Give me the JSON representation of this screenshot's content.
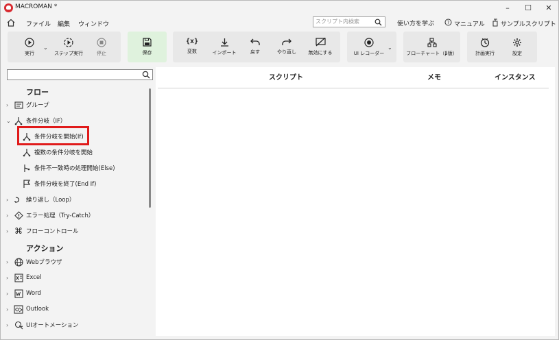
{
  "window": {
    "title": "MACROMAN *",
    "controls": [
      "minimize",
      "maximize",
      "close"
    ]
  },
  "menu": {
    "items": [
      "ファイル",
      "編集",
      "ウィンドウ"
    ],
    "search_placeholder": "スクリプト内検索",
    "links": [
      "使い方を学ぶ",
      "マニュアル",
      "サンプルスクリプト"
    ]
  },
  "toolbar": {
    "run": "実行",
    "step_run": "ステップ実行",
    "stop": "停止",
    "save": "保存",
    "variables": "変数",
    "import": "インポート",
    "undo": "戻す",
    "redo": "やり直し",
    "disable": "無効にする",
    "ui_recorder": "UI レコーダー",
    "flowchart": "フローチャート（β版）",
    "schedule": "計画実行",
    "settings": "設定"
  },
  "sidebar": {
    "section_flow": "フロー",
    "section_action": "アクション",
    "items": [
      {
        "label": "グループ",
        "icon": "group-icon"
      },
      {
        "label": "条件分岐（IF）",
        "icon": "branch-icon"
      },
      {
        "label": "条件分岐を開始(If)",
        "icon": "branch-icon"
      },
      {
        "label": "複数の条件分岐を開始",
        "icon": "branch-icon"
      },
      {
        "label": "条件不一致時の処理開始(Else)",
        "icon": "else-icon"
      },
      {
        "label": "条件分岐を終了(End If)",
        "icon": "flag-icon"
      },
      {
        "label": "繰り返し（Loop）",
        "icon": "loop-icon"
      },
      {
        "label": "エラー処理（Try-Catch）",
        "icon": "warning-icon"
      },
      {
        "label": "フローコントロール",
        "icon": "command-icon"
      },
      {
        "label": "Webブラウザ",
        "icon": "globe-icon"
      },
      {
        "label": "Excel",
        "icon": "excel-icon"
      },
      {
        "label": "Word",
        "icon": "word-icon"
      },
      {
        "label": "Outlook",
        "icon": "outlook-icon"
      },
      {
        "label": "UIオートメーション",
        "icon": "ui-automation-icon"
      }
    ]
  },
  "main": {
    "columns": [
      "スクリプト",
      "メモ",
      "インスタンス"
    ]
  },
  "colors": {
    "highlight": "#e01a1a",
    "save_group_bg": "#dff2dd"
  }
}
